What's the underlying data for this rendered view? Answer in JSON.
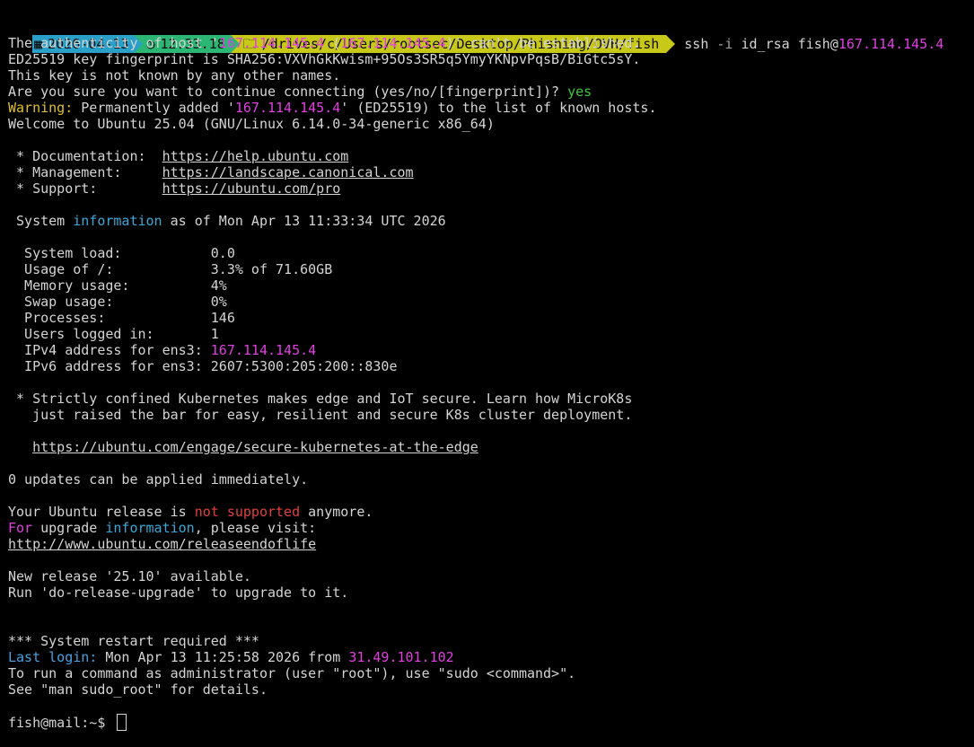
{
  "prompt": {
    "date": "2026-04-13",
    "time": "12:33.18",
    "path": "/drives/c/Users/rootsec/Desktop/Phishing/OVH/fish",
    "cmd_prefix": "ssh ",
    "cmd_flag": "-i",
    "cmd_mid": " id_rsa fish@",
    "host": "167.114.145.4"
  },
  "auth": {
    "l1a": "The authenticity of host '",
    "ip1": "167.114.145.4",
    "l1b": " (",
    "ip2": "167.114.145.4",
    "l1c": ")' can't be established.",
    "l2": "ED25519 key fingerprint is SHA256:VXVhGkKwism+95Os3SR5q5YmyYKNpvPqsB/BiGtc5sY.",
    "l3": "This key is not known by any other names.",
    "l4a": "Are you sure you want to continue connecting (yes/no/[fingerprint])? ",
    "l4b": "yes",
    "warn": "Warning:",
    "l5a": " Permanently added '",
    "ip3": "167.114.145.4",
    "l5b": "' (ED25519) to the list of known hosts.",
    "l6": "Welcome to Ubuntu 25.04 (GNU/Linux 6.14.0-34-generic x86_64)"
  },
  "links": {
    "doc_label": " * Documentation:  ",
    "doc_url": "https://help.ubuntu.com",
    "mgmt_label": " * Management:     ",
    "mgmt_url": "https://landscape.canonical.com",
    "sup_label": " * Support:        ",
    "sup_url": "https://ubuntu.com/pro"
  },
  "sysinfo": {
    "header_a": " System ",
    "header_b": "information",
    "header_c": " as of Mon Apr 13 11:33:34 UTC 2026",
    "load": "  System load:           0.0",
    "usage": "  Usage of /:            3.3% of 71.60GB",
    "memory": "  Memory usage:          4%",
    "swap": "  Swap usage:            0%",
    "procs": "  Processes:             146",
    "users": "  Users logged in:       1",
    "ipv4_label": "  IPv4 address for ens3: ",
    "ipv4": "167.114.145.4",
    "ipv6": "  IPv6 address for ens3: 2607:5300:205:200::830e"
  },
  "k8s": {
    "l1": " * Strictly confined Kubernetes makes edge and IoT secure. Learn how MicroK8s",
    "l2": "   just raised the bar for easy, resilient and secure K8s cluster deployment.",
    "url_indent": "   ",
    "url": "https://ubuntu.com/engage/secure-kubernetes-at-the-edge"
  },
  "updates": {
    "l1": "0 updates can be applied immediately.",
    "rel_a": "Your Ubuntu release is ",
    "rel_b": "not supported",
    "rel_c": " anymore.",
    "up_a": "For",
    "up_b": " upgrade ",
    "up_c": "information",
    "up_d": ", please visit:",
    "eol_url": "http://www.ubuntu.com/releaseendoflife",
    "new_rel": "New release '25.10' available.",
    "run": "Run 'do-release-upgrade' to upgrade to it."
  },
  "footer": {
    "restart": "*** System restart required ***",
    "last_a": "Last login:",
    "last_b": " Mon Apr 13 11:25:58 2026 from ",
    "last_ip": "31.49.101.102",
    "admin": "To run a command as administrator (user \"root\"), use \"sudo <command>\".",
    "man": "See \"man sudo_root\" for details.",
    "shell_prompt": "fish@mail:~$ "
  },
  "icons": {
    "calendar": "calendar-icon",
    "clock": "clock-icon",
    "folder": "folder-icon"
  },
  "colors": {
    "date_bg": "#2aa0c8",
    "time_bg": "#2bb673",
    "path_bg": "#c8c818",
    "highlight_ip": "#e040e0",
    "warning": "#e0c030",
    "info": "#3aa8d8",
    "error": "#e04040"
  }
}
